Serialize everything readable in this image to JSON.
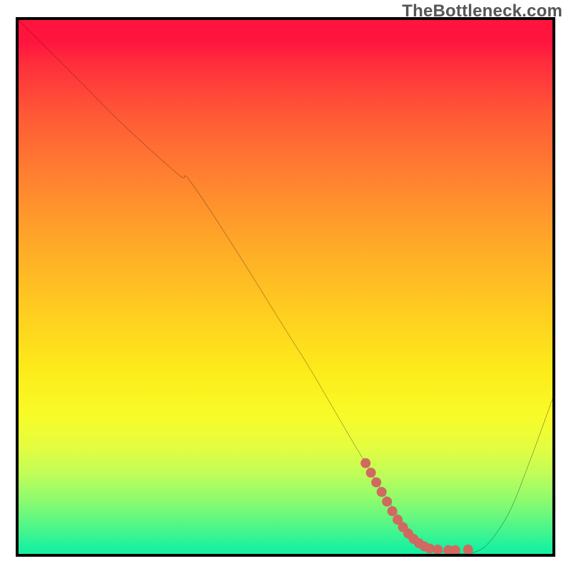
{
  "watermark": "TheBottleneck.com",
  "chart_data": {
    "type": "line",
    "title": "",
    "xlabel": "",
    "ylabel": "",
    "xlim": [
      0,
      100
    ],
    "ylim": [
      0,
      100
    ],
    "series": [
      {
        "name": "bottleneck-curve",
        "x": [
          0,
          5,
          12,
          20,
          30,
          32,
          40,
          50,
          55,
          62,
          65,
          68,
          72,
          76,
          80,
          82,
          85,
          88,
          92,
          96,
          100
        ],
        "y": [
          100,
          95,
          88,
          80,
          71,
          70,
          58,
          42,
          34,
          22,
          17,
          12,
          6,
          2,
          0.2,
          0.05,
          0.2,
          2,
          8,
          18,
          29
        ]
      }
    ],
    "highlight_dots": {
      "name": "recommended-range",
      "color": "#d06a60",
      "points": [
        {
          "x": 65,
          "y": 17
        },
        {
          "x": 66,
          "y": 15.2
        },
        {
          "x": 67,
          "y": 13.4
        },
        {
          "x": 68,
          "y": 11.6
        },
        {
          "x": 69,
          "y": 9.8
        },
        {
          "x": 70,
          "y": 8.0
        },
        {
          "x": 71,
          "y": 6.4
        },
        {
          "x": 72,
          "y": 5.0
        },
        {
          "x": 73,
          "y": 3.8
        },
        {
          "x": 74,
          "y": 2.8
        },
        {
          "x": 75,
          "y": 2.0
        },
        {
          "x": 76,
          "y": 1.4
        },
        {
          "x": 77,
          "y": 1.0
        },
        {
          "x": 78.5,
          "y": 0.8
        },
        {
          "x": 80.5,
          "y": 0.7
        },
        {
          "x": 81.8,
          "y": 0.7
        },
        {
          "x": 84.2,
          "y": 0.8
        }
      ]
    },
    "gradient_colors": {
      "top": "#ff143e",
      "mid": "#ffe11d",
      "bottom": "#19f1a0"
    }
  }
}
